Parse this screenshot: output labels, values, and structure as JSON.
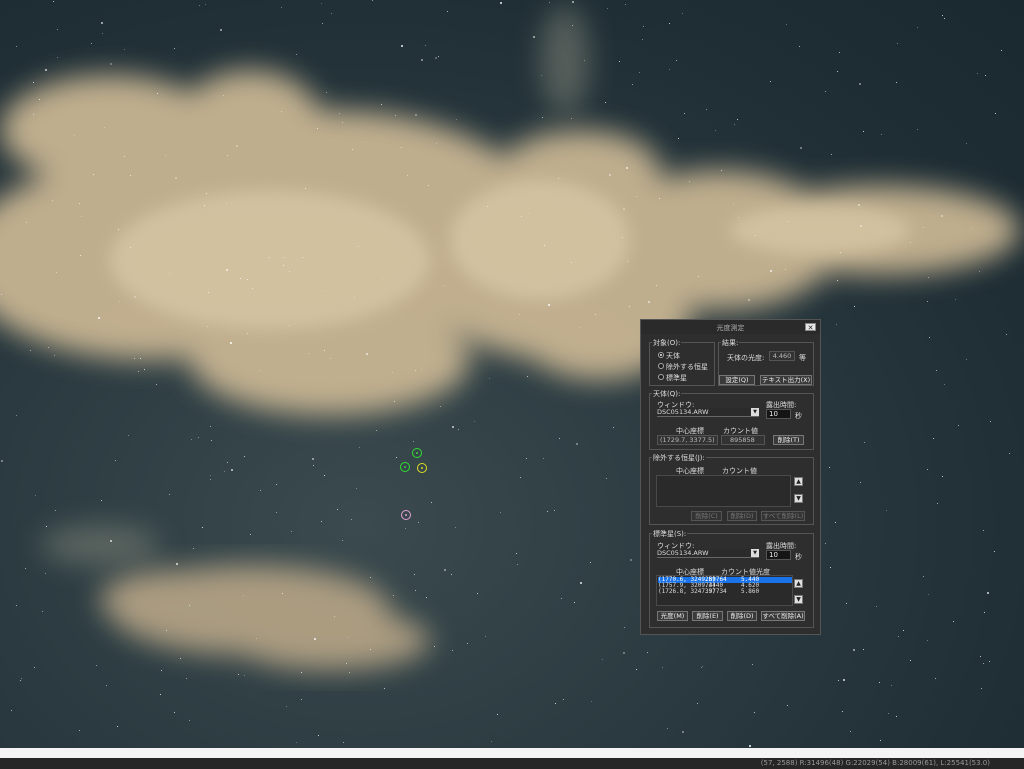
{
  "dialog": {
    "title": "光度測定",
    "close_label": "✕",
    "target": {
      "legend": "対象(O):",
      "options": [
        {
          "label": "天体",
          "selected": true
        },
        {
          "label": "除外する恒星",
          "selected": false
        },
        {
          "label": "標準星",
          "selected": false
        }
      ]
    },
    "result": {
      "legend": "結果:",
      "magnitude_label": "天体の光度:",
      "magnitude_value": "4.460",
      "unit": "等",
      "settings_button": "設定(Q)",
      "text_output_button": "テキスト出力(X)"
    },
    "object": {
      "legend": "天体(Q):",
      "window_label": "ウィンドウ:",
      "window_value": "DSC05134.ARW",
      "exposure_label": "露出時間:",
      "exposure_value": "10",
      "exposure_unit": "秒",
      "center_header": "中心座標",
      "count_header": "カウント値",
      "center_value": "(1729.7, 3377.5)",
      "count_value": "895858",
      "delete_button": "削除(T)"
    },
    "excluded": {
      "legend": "除外する恒星(J):",
      "center_header": "中心座標",
      "count_header": "カウント値",
      "delete_button": "削除(C)",
      "remove_button": "削除(D)",
      "remove_all_button": "すべて削除(L)"
    },
    "standard": {
      "legend": "標準星(S):",
      "window_label": "ウィンドウ:",
      "window_value": "DSC05134.ARW",
      "exposure_label": "露出時間:",
      "exposure_value": "10",
      "exposure_unit": "秒",
      "center_header": "中心座標",
      "count_header": "カウント値",
      "mag_header": "光度",
      "rows": [
        {
          "center": "(1770.6, 3249.5)",
          "count": "289764",
          "mag": "5.440",
          "selected": true
        },
        {
          "center": "(1757.9, 3209.3)",
          "count": "74440",
          "mag": "4.620",
          "selected": false
        },
        {
          "center": "(1726.8, 3247.9)",
          "count": "337734",
          "mag": "5.860",
          "selected": false
        }
      ],
      "mag_button": "光度(M)",
      "delete_button": "削除(E)",
      "remove_button": "削除(D)",
      "remove_all_button": "すべて削除(A)"
    }
  },
  "status_bar": {
    "text": "(57, 2588) R:31496(48) G:22029(54) B:28009(61), L:25541(53.0)"
  },
  "colors": {
    "marker_object": "#33dd33",
    "marker_excluded": "#dddd22",
    "marker_standard": "#e6a0d8",
    "list_selection": "#1a73e8"
  }
}
